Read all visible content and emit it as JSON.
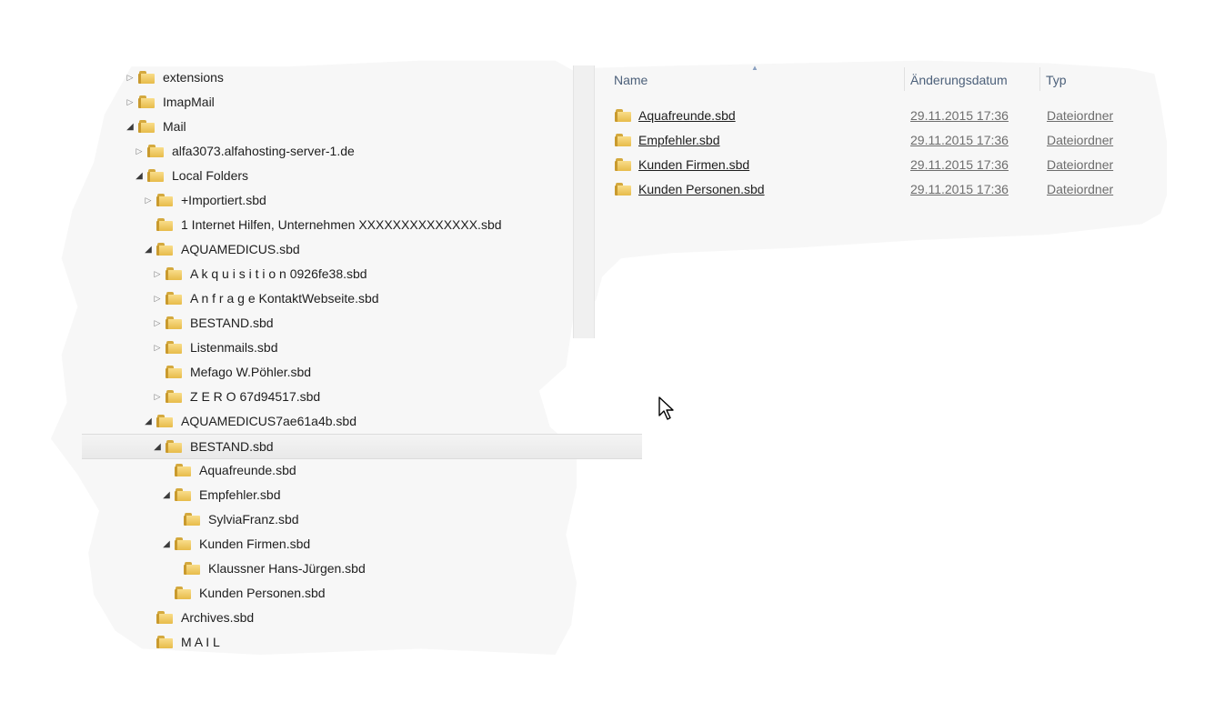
{
  "tree": [
    {
      "label": "extensions",
      "level": 0,
      "state": "collapsed"
    },
    {
      "label": "ImapMail",
      "level": 0,
      "state": "collapsed"
    },
    {
      "label": "Mail",
      "level": 0,
      "state": "expanded"
    },
    {
      "label": "alfa3073.alfahosting-server-1.de",
      "level": 1,
      "state": "collapsed"
    },
    {
      "label": "Local Folders",
      "level": 1,
      "state": "expanded"
    },
    {
      "label": "+Importiert.sbd",
      "level": 2,
      "state": "collapsed"
    },
    {
      "label": "1 Internet Hilfen, Unternehmen XXXXXXXXXXXXXX.sbd",
      "level": 2,
      "state": "none"
    },
    {
      "label": "AQUAMEDICUS.sbd",
      "level": 2,
      "state": "expanded"
    },
    {
      "label": "A k q u i s i t i o n 0926fe38.sbd",
      "level": 3,
      "state": "collapsed"
    },
    {
      "label": "A n f r a g e  KontaktWebseite.sbd",
      "level": 3,
      "state": "collapsed"
    },
    {
      "label": "BESTAND.sbd",
      "level": 3,
      "state": "collapsed"
    },
    {
      "label": "Listenmails.sbd",
      "level": 3,
      "state": "collapsed"
    },
    {
      "label": "Mefago W.Pöhler.sbd",
      "level": 3,
      "state": "none"
    },
    {
      "label": "Z E R O  67d94517.sbd",
      "level": 3,
      "state": "collapsed"
    },
    {
      "label": "AQUAMEDICUS7ae61a4b.sbd",
      "level": 2,
      "state": "expanded"
    },
    {
      "label": "BESTAND.sbd",
      "level": 3,
      "state": "expanded",
      "selected": true
    },
    {
      "label": "Aquafreunde.sbd",
      "level": 4,
      "state": "none"
    },
    {
      "label": "Empfehler.sbd",
      "level": 4,
      "state": "expanded"
    },
    {
      "label": "SylviaFranz.sbd",
      "level": 5,
      "state": "none"
    },
    {
      "label": "Kunden Firmen.sbd",
      "level": 4,
      "state": "expanded"
    },
    {
      "label": "Klaussner Hans-Jürgen.sbd",
      "level": 5,
      "state": "none"
    },
    {
      "label": "Kunden Personen.sbd",
      "level": 4,
      "state": "none"
    },
    {
      "label": "Archives.sbd",
      "level": 2,
      "state": "none"
    },
    {
      "label": "M A I L",
      "level": 2,
      "state": "none"
    }
  ],
  "list": {
    "columns": {
      "name": "Name",
      "date": "Änderungsdatum",
      "type": "Typ"
    },
    "rows": [
      {
        "name": "Aquafreunde.sbd",
        "date": "29.11.2015 17:36",
        "type": "Dateiordner"
      },
      {
        "name": "Empfehler.sbd",
        "date": "29.11.2015 17:36",
        "type": "Dateiordner"
      },
      {
        "name": "Kunden Firmen.sbd",
        "date": "29.11.2015 17:36",
        "type": "Dateiordner"
      },
      {
        "name": "Kunden Personen.sbd",
        "date": "29.11.2015 17:36",
        "type": "Dateiordner"
      }
    ]
  },
  "icons": {
    "expander_collapsed": "triangle-right-icon",
    "expander_expanded": "triangle-down-icon",
    "folder": "folder-icon"
  }
}
